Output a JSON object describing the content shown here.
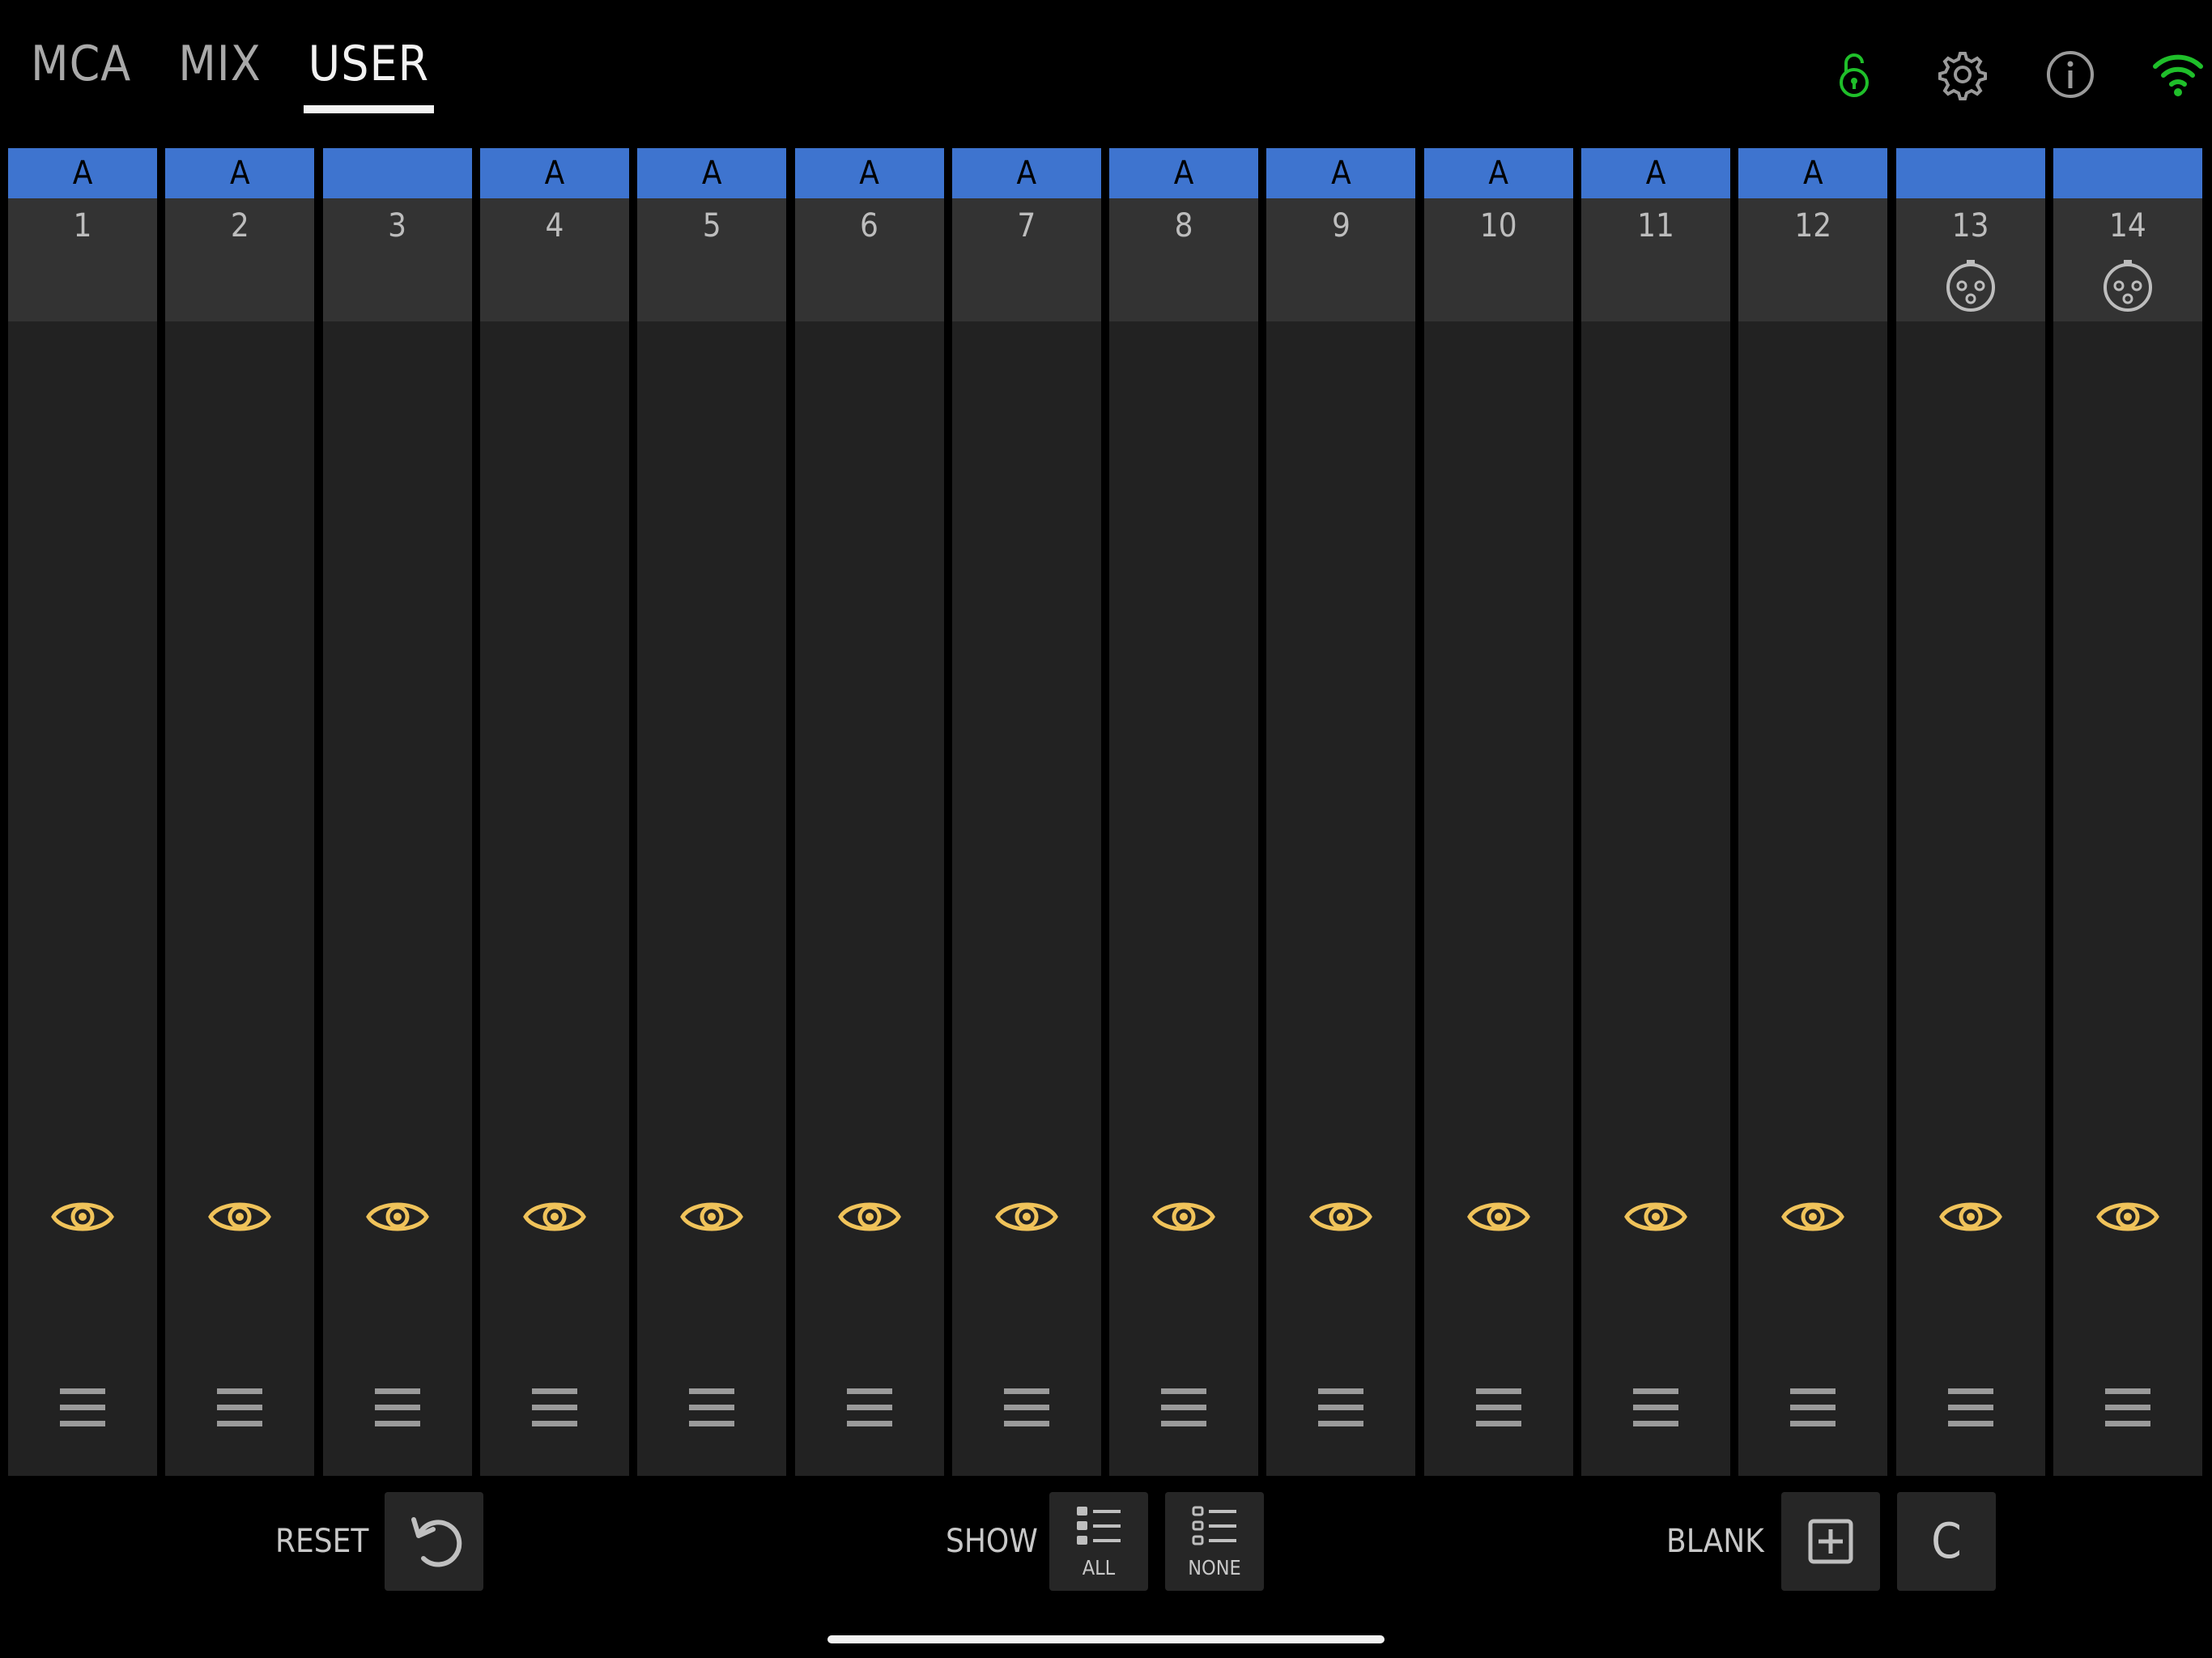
{
  "tabs": [
    {
      "label": "MCA",
      "active": false
    },
    {
      "label": "MIX",
      "active": false
    },
    {
      "label": "USER",
      "active": true
    }
  ],
  "top_icons": [
    "unlock-icon",
    "gear-icon",
    "info-icon",
    "wifi-icon"
  ],
  "colors": {
    "background": "#000000",
    "strip": "#222222",
    "strip_header": "#333333",
    "tag_blue": "#3e74cf",
    "eye_gold": "#f0c35a",
    "status_green": "#1fbf2a"
  },
  "strips": [
    {
      "tag": "A",
      "number": "1",
      "icon": ""
    },
    {
      "tag": "A",
      "number": "2",
      "icon": ""
    },
    {
      "tag": "",
      "number": "3",
      "icon": ""
    },
    {
      "tag": "A",
      "number": "4",
      "icon": ""
    },
    {
      "tag": "A",
      "number": "5",
      "icon": ""
    },
    {
      "tag": "A",
      "number": "6",
      "icon": ""
    },
    {
      "tag": "A",
      "number": "7",
      "icon": ""
    },
    {
      "tag": "A",
      "number": "8",
      "icon": ""
    },
    {
      "tag": "A",
      "number": "9",
      "icon": ""
    },
    {
      "tag": "A",
      "number": "10",
      "icon": ""
    },
    {
      "tag": "A",
      "number": "11",
      "icon": ""
    },
    {
      "tag": "A",
      "number": "12",
      "icon": ""
    },
    {
      "tag": "",
      "number": "13",
      "icon": "xlr-icon"
    },
    {
      "tag": "",
      "number": "14",
      "icon": "xlr-icon"
    }
  ],
  "bottom": {
    "reset_label": "RESET",
    "show_label": "SHOW",
    "show_all": "ALL",
    "show_none": "NONE",
    "blank_label": "BLANK",
    "c_button": "C"
  }
}
